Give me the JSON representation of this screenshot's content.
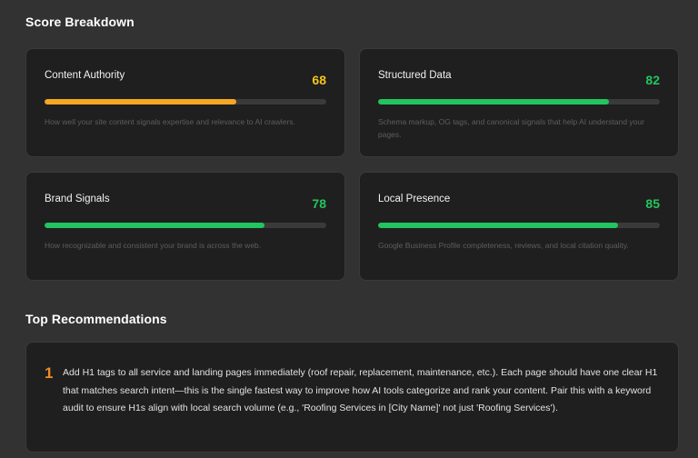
{
  "score_breakdown": {
    "title": "Score Breakdown",
    "cards": [
      {
        "label": "Content Authority",
        "score": "68",
        "value": 68,
        "color": "#f5a623",
        "score_color": "#f5c518",
        "description": "How well your site content signals expertise and relevance to AI crawlers."
      },
      {
        "label": "Structured Data",
        "score": "82",
        "value": 82,
        "color": "#22c55e",
        "score_color": "#22c55e",
        "description": "Schema markup, OG tags, and canonical signals that help AI understand your pages."
      },
      {
        "label": "Brand Signals",
        "score": "78",
        "value": 78,
        "color": "#22c55e",
        "score_color": "#22c55e",
        "description": "How recognizable and consistent your brand is across the web."
      },
      {
        "label": "Local Presence",
        "score": "85",
        "value": 85,
        "color": "#22c55e",
        "score_color": "#22c55e",
        "description": "Google Business Profile completeness, reviews, and local citation quality."
      }
    ]
  },
  "recommendations": {
    "title": "Top Recommendations",
    "items": [
      {
        "number": "1",
        "text": "Add H1 tags to all service and landing pages immediately (roof repair, replacement, maintenance, etc.). Each page should have one clear H1 that matches search intent—this is the single fastest way to improve how AI tools categorize and rank your content. Pair this with a keyword audit to ensure H1s align with local search volume (e.g., 'Roofing Services in [City Name]' not just 'Roofing Services')."
      }
    ]
  }
}
